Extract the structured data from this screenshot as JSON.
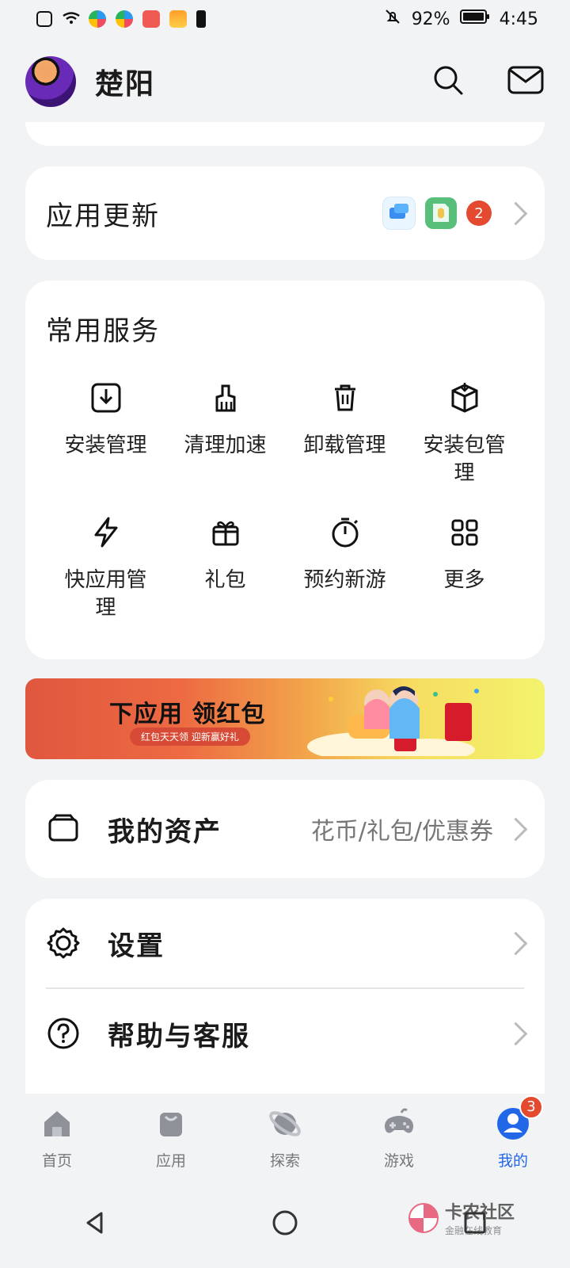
{
  "status_bar": {
    "battery": "92%",
    "time": "4:45"
  },
  "header": {
    "username": "楚阳"
  },
  "app_updates": {
    "title": "应用更新",
    "count": "2"
  },
  "services": {
    "title": "常用服务",
    "items": [
      {
        "label": "安装管理"
      },
      {
        "label": "清理加速"
      },
      {
        "label": "卸载管理"
      },
      {
        "label": "安装包管理"
      },
      {
        "label": "快应用管理"
      },
      {
        "label": "礼包"
      },
      {
        "label": "预约新游"
      },
      {
        "label": "更多"
      }
    ]
  },
  "banner": {
    "title": "下应用 领红包",
    "subtitle": "红包天天领 迎新赢好礼"
  },
  "assets": {
    "title": "我的资产",
    "details": "花币/礼包/优惠券"
  },
  "menu": {
    "items": [
      {
        "label": "设置"
      },
      {
        "label": "帮助与客服"
      }
    ]
  },
  "bottom_nav": {
    "items": [
      {
        "label": "首页"
      },
      {
        "label": "应用"
      },
      {
        "label": "探索"
      },
      {
        "label": "游戏"
      },
      {
        "label": "我的",
        "badge": "3"
      }
    ]
  },
  "watermark": {
    "main": "卡农社区",
    "sub": "金融在线教育"
  }
}
